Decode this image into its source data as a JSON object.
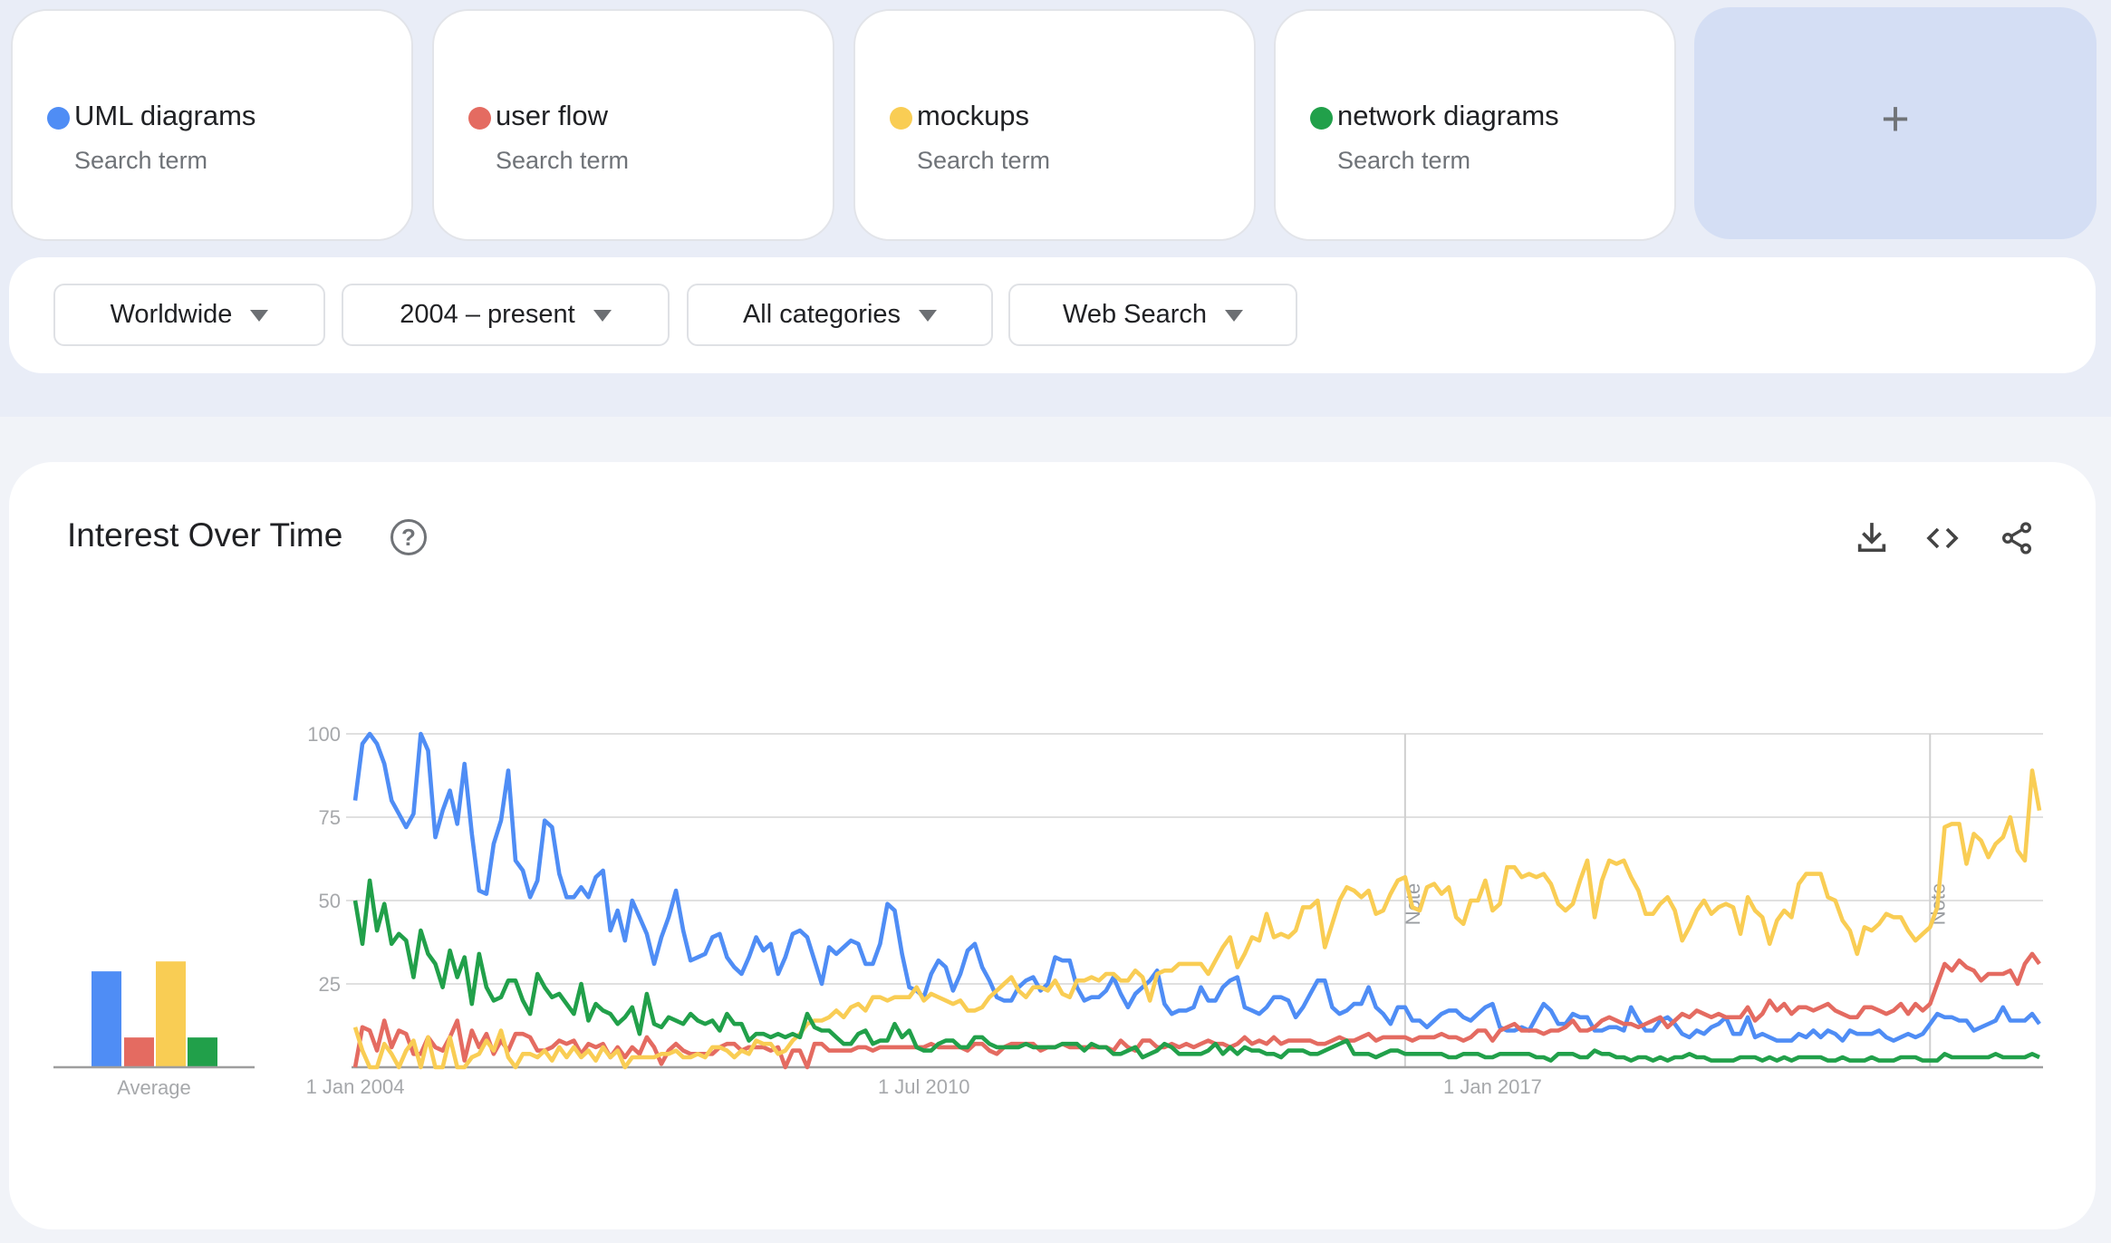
{
  "terms": [
    {
      "name": "UML diagrams",
      "subtitle": "Search term",
      "color": "#4f8df5"
    },
    {
      "name": "user flow",
      "subtitle": "Search term",
      "color": "#e46b61"
    },
    {
      "name": "mockups",
      "subtitle": "Search term",
      "color": "#f9cd54"
    },
    {
      "name": "network diagrams",
      "subtitle": "Search term",
      "color": "#21a04a"
    }
  ],
  "add_term": {
    "label": "+"
  },
  "filters": {
    "region": "Worldwide",
    "time_range": "2004 – present",
    "category": "All categories",
    "search_type": "Web Search"
  },
  "interest_over_time": {
    "title": "Interest Over Time",
    "help_icon": "?",
    "actions": [
      "download-icon",
      "embed-code-icon",
      "share-icon"
    ]
  },
  "chart_data": [
    {
      "type": "bar",
      "title": "Average",
      "categories": [
        "UML diagrams",
        "user flow",
        "mockups",
        "network diagrams"
      ],
      "values": [
        29,
        9,
        32,
        9
      ],
      "colors": [
        "#4f8df5",
        "#e46b61",
        "#f9cd54",
        "#21a04a"
      ],
      "xlabel": "Average",
      "ylim": [
        0,
        100
      ]
    },
    {
      "type": "line",
      "title": "Interest Over Time",
      "x_start": "2004-01",
      "x_step": "month",
      "x_ticks": [
        {
          "label": "1 Jan 2004",
          "index": 0
        },
        {
          "label": "1 Jul 2010",
          "index": 78
        },
        {
          "label": "1 Jan 2017",
          "index": 156
        }
      ],
      "y_ticks": [
        100,
        75,
        50,
        25
      ],
      "ylim": [
        0,
        100
      ],
      "grid": true,
      "notes": [
        {
          "label": "Note",
          "index": 144
        },
        {
          "label": "Note",
          "index": 216
        }
      ],
      "series": [
        {
          "name": "UML diagrams",
          "color": "#4f8df5",
          "values": [
            80,
            97,
            100,
            97,
            91,
            80,
            76,
            72,
            76,
            100,
            95,
            69,
            77,
            83,
            73,
            91,
            70,
            53,
            52,
            67,
            74,
            89,
            62,
            59,
            51,
            56,
            74,
            72,
            58,
            51,
            51,
            54,
            51,
            57,
            59,
            41,
            47,
            38,
            50,
            45,
            40,
            31,
            39,
            45,
            53,
            41,
            32,
            33,
            34,
            39,
            40,
            33,
            30,
            28,
            33,
            39,
            35,
            37,
            28,
            33,
            40,
            41,
            39,
            32,
            25,
            36,
            34,
            36,
            38,
            37,
            31,
            31,
            37,
            49,
            47,
            34,
            24,
            23,
            21,
            28,
            32,
            30,
            23,
            28,
            35,
            37,
            30,
            26,
            21,
            20,
            20,
            24,
            26,
            27,
            23,
            25,
            33,
            32,
            32,
            24,
            20,
            21,
            21,
            23,
            27,
            22,
            18,
            22,
            24,
            26,
            29,
            19,
            16,
            17,
            17,
            18,
            24,
            20,
            20,
            24,
            26,
            27,
            18,
            17,
            16,
            18,
            21,
            21,
            20,
            15,
            18,
            22,
            26,
            26,
            18,
            16,
            17,
            19,
            19,
            24,
            18,
            16,
            13,
            18,
            18,
            14,
            14,
            12,
            14,
            16,
            17,
            17,
            15,
            14,
            16,
            18,
            19,
            12,
            11,
            11,
            12,
            11,
            15,
            19,
            17,
            13,
            13,
            16,
            15,
            15,
            11,
            11,
            12,
            12,
            11,
            18,
            14,
            11,
            11,
            14,
            15,
            13,
            10,
            9,
            11,
            10,
            12,
            13,
            15,
            10,
            10,
            15,
            9,
            10,
            9,
            8,
            8,
            8,
            10,
            9,
            11,
            9,
            11,
            10,
            8,
            11,
            10,
            10,
            10,
            11,
            9,
            8,
            9,
            10,
            9,
            10,
            13,
            16,
            15,
            15,
            14,
            14,
            11,
            12,
            13,
            14,
            18,
            14,
            14,
            14,
            16,
            13
          ]
        },
        {
          "name": "user flow",
          "color": "#e46b61",
          "values": [
            0,
            12,
            11,
            5,
            14,
            6,
            11,
            10,
            4,
            4,
            9,
            6,
            5,
            9,
            14,
            2,
            11,
            6,
            10,
            4,
            8,
            5,
            10,
            10,
            9,
            5,
            5,
            6,
            8,
            7,
            8,
            4,
            7,
            6,
            7,
            3,
            6,
            3,
            6,
            4,
            9,
            6,
            1,
            5,
            7,
            5,
            4,
            4,
            4,
            4,
            6,
            7,
            7,
            5,
            6,
            6,
            6,
            5,
            6,
            0,
            5,
            5,
            0,
            7,
            7,
            5,
            5,
            5,
            5,
            6,
            6,
            5,
            6,
            6,
            6,
            6,
            6,
            6,
            6,
            7,
            6,
            6,
            6,
            6,
            5,
            7,
            7,
            5,
            4,
            6,
            7,
            7,
            7,
            7,
            5,
            6,
            6,
            7,
            6,
            6,
            6,
            6,
            6,
            6,
            5,
            8,
            6,
            5,
            8,
            8,
            6,
            6,
            7,
            6,
            7,
            6,
            7,
            8,
            7,
            7,
            6,
            7,
            9,
            7,
            8,
            7,
            9,
            7,
            8,
            8,
            8,
            8,
            7,
            7,
            8,
            9,
            8,
            8,
            9,
            10,
            8,
            9,
            9,
            9,
            9,
            8,
            9,
            9,
            9,
            10,
            9,
            9,
            8,
            9,
            11,
            11,
            8,
            11,
            12,
            13,
            11,
            11,
            11,
            10,
            11,
            11,
            12,
            14,
            11,
            11,
            12,
            14,
            15,
            14,
            13,
            13,
            12,
            13,
            14,
            15,
            12,
            14,
            16,
            15,
            17,
            16,
            15,
            16,
            15,
            15,
            15,
            18,
            14,
            16,
            20,
            17,
            19,
            16,
            18,
            18,
            17,
            18,
            19,
            17,
            16,
            15,
            15,
            18,
            18,
            17,
            16,
            17,
            19,
            16,
            19,
            17,
            19,
            25,
            31,
            29,
            32,
            30,
            29,
            26,
            28,
            28,
            28,
            29,
            25,
            31,
            34,
            31
          ]
        },
        {
          "name": "mockups",
          "color": "#f9cd54",
          "values": [
            12,
            5,
            0,
            0,
            7,
            4,
            0,
            5,
            8,
            0,
            9,
            0,
            0,
            9,
            0,
            0,
            3,
            4,
            8,
            5,
            11,
            3,
            0,
            4,
            4,
            3,
            5,
            2,
            6,
            3,
            6,
            3,
            5,
            2,
            6,
            3,
            5,
            0,
            3,
            3,
            3,
            3,
            4,
            4,
            5,
            3,
            3,
            4,
            3,
            6,
            6,
            5,
            3,
            5,
            4,
            8,
            7,
            7,
            4,
            5,
            8,
            10,
            13,
            14,
            14,
            15,
            17,
            15,
            18,
            19,
            17,
            21,
            21,
            20,
            21,
            21,
            21,
            24,
            20,
            22,
            21,
            20,
            19,
            20,
            17,
            17,
            18,
            21,
            23,
            25,
            27,
            23,
            21,
            24,
            24,
            23,
            26,
            22,
            21,
            26,
            26,
            27,
            26,
            28,
            28,
            26,
            26,
            29,
            27,
            20,
            28,
            29,
            29,
            31,
            31,
            31,
            31,
            28,
            32,
            36,
            39,
            30,
            34,
            39,
            38,
            46,
            39,
            40,
            39,
            41,
            48,
            48,
            50,
            36,
            43,
            50,
            54,
            53,
            51,
            53,
            46,
            47,
            52,
            56,
            57,
            48,
            47,
            54,
            55,
            52,
            54,
            45,
            43,
            50,
            50,
            56,
            47,
            49,
            60,
            60,
            57,
            58,
            57,
            58,
            55,
            49,
            47,
            49,
            56,
            62,
            45,
            56,
            62,
            61,
            62,
            57,
            53,
            46,
            46,
            49,
            51,
            47,
            38,
            42,
            47,
            50,
            46,
            48,
            49,
            48,
            40,
            51,
            47,
            45,
            37,
            44,
            47,
            45,
            55,
            58,
            58,
            58,
            51,
            50,
            44,
            41,
            34,
            42,
            41,
            43,
            46,
            45,
            45,
            41,
            38,
            40,
            42,
            48,
            72,
            73,
            73,
            61,
            70,
            68,
            63,
            67,
            69,
            75,
            65,
            62,
            89,
            77
          ]
        },
        {
          "name": "network diagrams",
          "color": "#21a04a",
          "values": [
            50,
            37,
            56,
            41,
            49,
            37,
            40,
            38,
            27,
            41,
            34,
            31,
            24,
            35,
            27,
            33,
            19,
            34,
            24,
            20,
            21,
            26,
            26,
            20,
            16,
            28,
            24,
            21,
            22,
            19,
            16,
            25,
            14,
            19,
            17,
            16,
            13,
            15,
            18,
            10,
            22,
            13,
            12,
            15,
            14,
            13,
            16,
            14,
            13,
            14,
            11,
            16,
            13,
            13,
            8,
            10,
            10,
            9,
            10,
            9,
            10,
            9,
            16,
            12,
            11,
            11,
            9,
            7,
            7,
            10,
            11,
            7,
            8,
            8,
            13,
            9,
            11,
            6,
            5,
            5,
            7,
            8,
            8,
            6,
            6,
            9,
            9,
            7,
            6,
            6,
            6,
            6,
            7,
            6,
            6,
            6,
            6,
            7,
            7,
            7,
            5,
            7,
            6,
            6,
            4,
            4,
            5,
            6,
            3,
            4,
            5,
            7,
            6,
            4,
            4,
            4,
            4,
            5,
            7,
            4,
            6,
            4,
            6,
            5,
            5,
            4,
            4,
            3,
            5,
            5,
            5,
            4,
            4,
            5,
            6,
            7,
            8,
            4,
            4,
            4,
            3,
            4,
            5,
            5,
            4,
            4,
            4,
            4,
            4,
            4,
            3,
            3,
            4,
            4,
            4,
            3,
            3,
            4,
            4,
            4,
            4,
            4,
            3,
            3,
            2,
            4,
            4,
            4,
            3,
            3,
            5,
            4,
            4,
            3,
            3,
            2,
            3,
            3,
            2,
            3,
            2,
            3,
            3,
            4,
            3,
            3,
            2,
            2,
            2,
            2,
            3,
            3,
            3,
            2,
            3,
            2,
            3,
            2,
            3,
            3,
            3,
            3,
            2,
            2,
            3,
            2,
            2,
            2,
            3,
            2,
            2,
            2,
            3,
            3,
            3,
            2,
            2,
            2,
            4,
            3,
            3,
            3,
            3,
            3,
            3,
            4,
            3,
            3,
            3,
            3,
            4,
            3
          ]
        }
      ]
    }
  ]
}
